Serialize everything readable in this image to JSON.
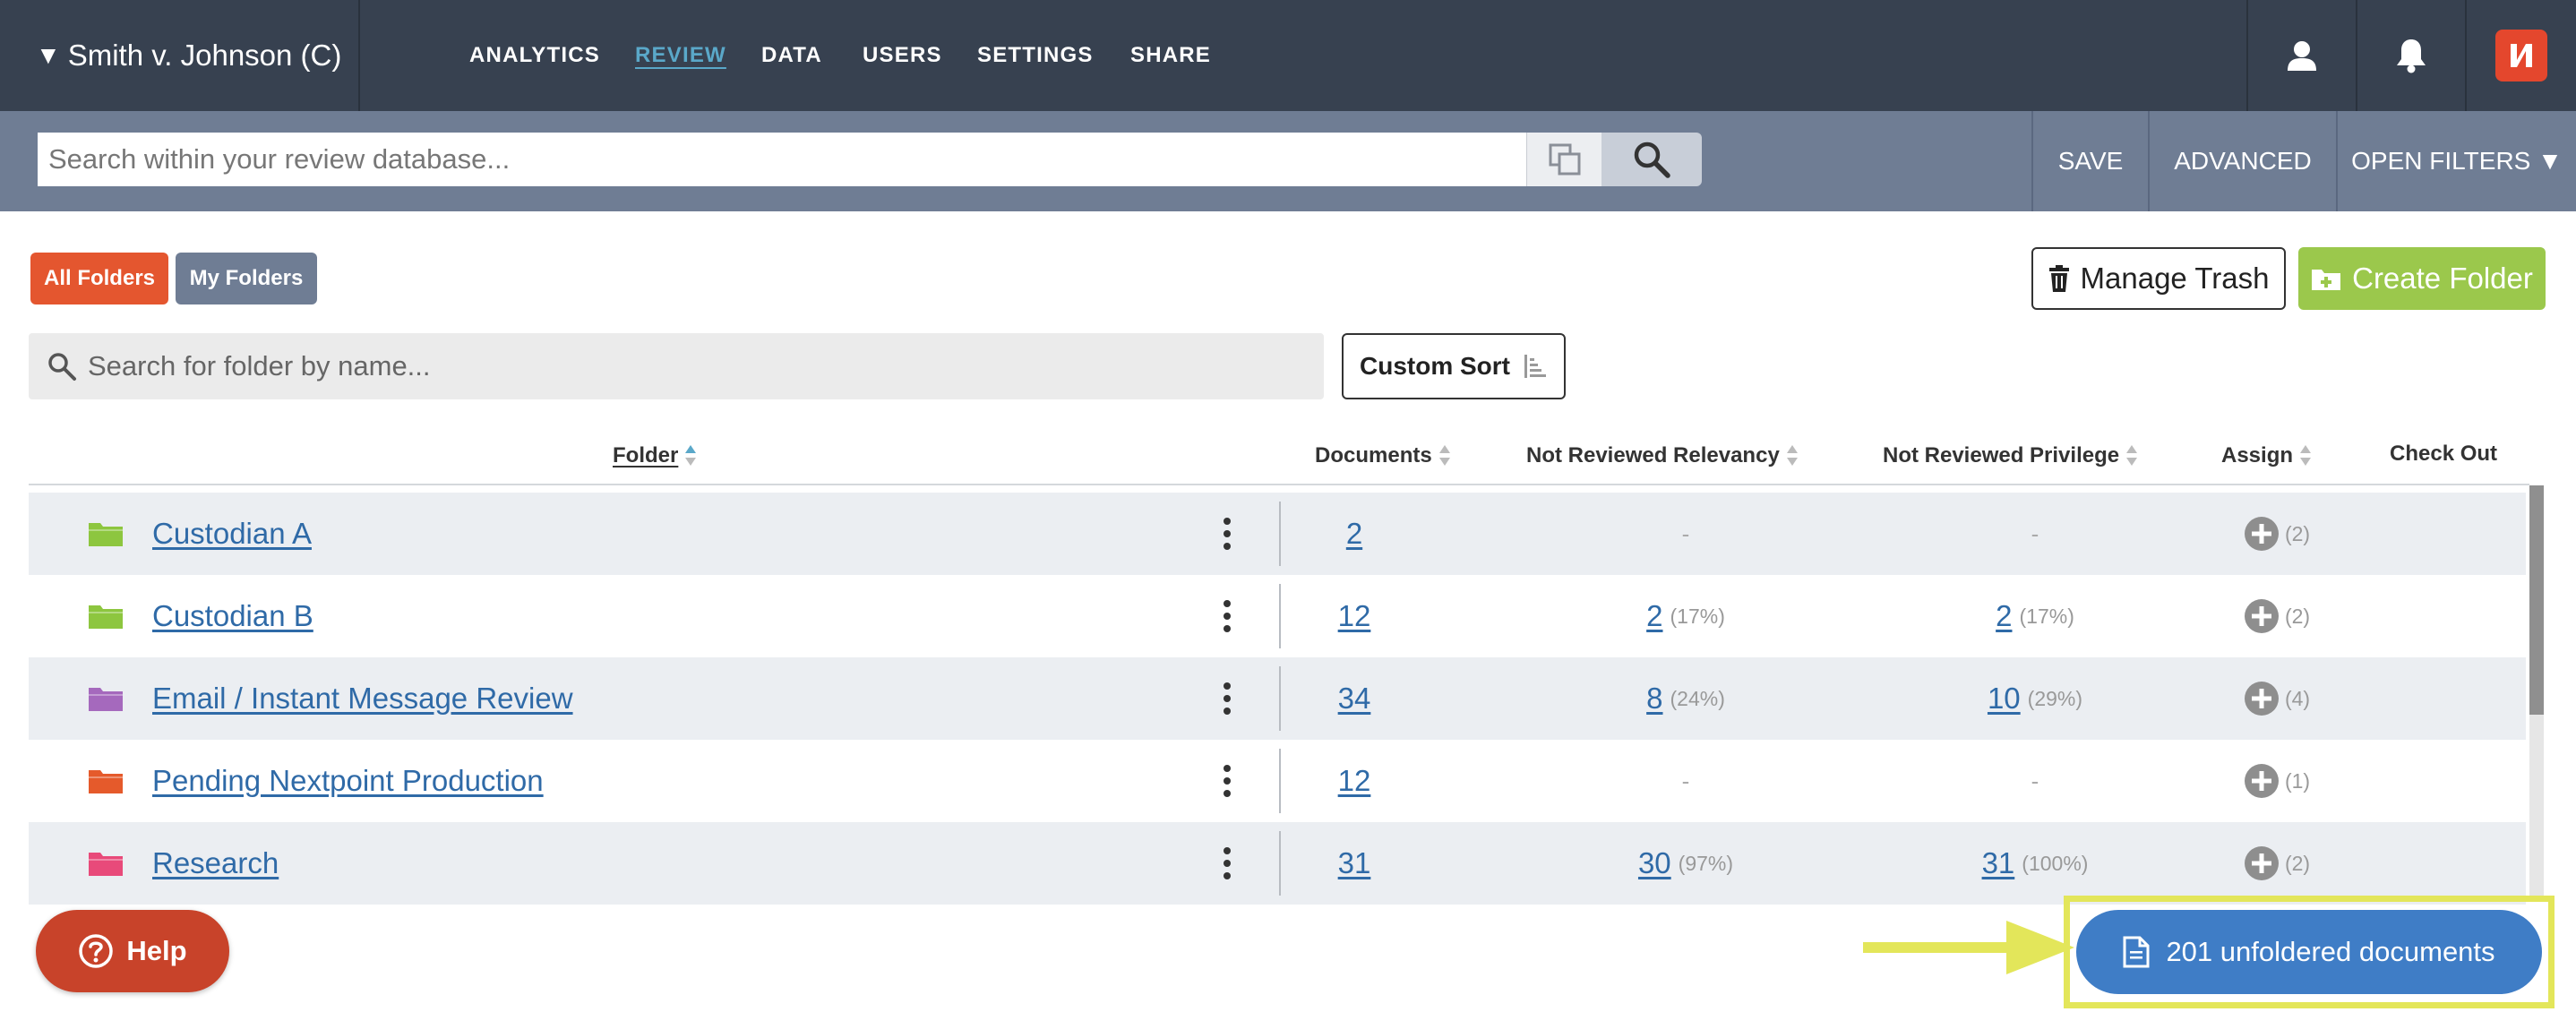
{
  "header": {
    "case_caret": "▼",
    "case_name": "Smith v. Johnson (C)",
    "nav": [
      "ANALYTICS",
      "REVIEW",
      "DATA",
      "USERS",
      "SETTINGS",
      "SHARE"
    ],
    "active_nav": "REVIEW",
    "icons": [
      "user-icon",
      "bell-icon",
      "nextpoint-logo"
    ]
  },
  "search": {
    "placeholder": "Search within your review database...",
    "value": "",
    "save_label": "SAVE",
    "advanced_label": "ADVANCED",
    "open_filters_label": "OPEN FILTERS ▼"
  },
  "folders": {
    "all_folders_label": "All Folders",
    "my_folders_label": "My Folders",
    "manage_trash_label": "Manage Trash",
    "create_folder_label": "Create Folder",
    "search_placeholder": "Search for folder by name...",
    "custom_sort_label": "Custom Sort"
  },
  "table": {
    "columns": {
      "folder": "Folder",
      "documents": "Documents",
      "nr_relevancy": "Not Reviewed Relevancy",
      "nr_privilege": "Not Reviewed Privilege",
      "assign": "Assign",
      "check_out": "Check Out"
    },
    "rows": [
      {
        "name": "Custodian A",
        "color": "#8dc63f",
        "documents": "2",
        "rel": "-",
        "rel_pct": "",
        "priv": "-",
        "priv_pct": "",
        "assign": "(2)"
      },
      {
        "name": "Custodian B",
        "color": "#8dc63f",
        "documents": "12",
        "rel": "2",
        "rel_pct": "(17%)",
        "priv": "2",
        "priv_pct": "(17%)",
        "assign": "(2)"
      },
      {
        "name": "Email / Instant Message Review",
        "color": "#a569bd",
        "documents": "34",
        "rel": "8",
        "rel_pct": "(24%)",
        "priv": "10",
        "priv_pct": "(29%)",
        "assign": "(4)"
      },
      {
        "name": "Pending Nextpoint Production",
        "color": "#e55a2b",
        "documents": "12",
        "rel": "-",
        "rel_pct": "",
        "priv": "-",
        "priv_pct": "",
        "assign": "(1)"
      },
      {
        "name": "Research",
        "color": "#e84a7a",
        "documents": "31",
        "rel": "30",
        "rel_pct": "(97%)",
        "priv": "31",
        "priv_pct": "(100%)",
        "assign": "(2)"
      }
    ]
  },
  "help_label": "Help",
  "unfoldered_label": "201 unfoldered documents",
  "colors": {
    "nav_bg": "#374150",
    "search_bg": "#6f7d94",
    "orange": "#e4562f",
    "green": "#9bc84c",
    "link": "#2f6aa7",
    "highlight": "#e3e65a",
    "unfoldered_bg": "#3f7dc6"
  }
}
